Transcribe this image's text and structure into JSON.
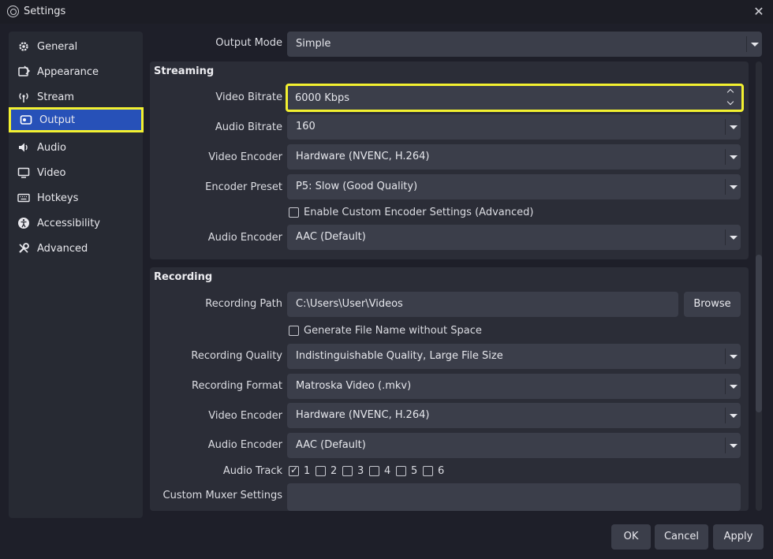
{
  "window": {
    "title": "Settings",
    "close": "✕"
  },
  "sidebar": {
    "items": [
      {
        "label": "General",
        "icon": "gear-icon"
      },
      {
        "label": "Appearance",
        "icon": "palette-icon"
      },
      {
        "label": "Stream",
        "icon": "antenna-icon"
      },
      {
        "label": "Output",
        "icon": "output-icon",
        "active": true
      },
      {
        "label": "Audio",
        "icon": "speaker-icon"
      },
      {
        "label": "Video",
        "icon": "monitor-icon"
      },
      {
        "label": "Hotkeys",
        "icon": "keyboard-icon"
      },
      {
        "label": "Accessibility",
        "icon": "accessibility-icon"
      },
      {
        "label": "Advanced",
        "icon": "wrench-icon"
      }
    ]
  },
  "output_mode": {
    "label": "Output Mode",
    "value": "Simple"
  },
  "streaming": {
    "title": "Streaming",
    "video_bitrate": {
      "label": "Video Bitrate",
      "value": "6000 Kbps"
    },
    "audio_bitrate": {
      "label": "Audio Bitrate",
      "value": "160"
    },
    "video_encoder": {
      "label": "Video Encoder",
      "value": "Hardware (NVENC, H.264)"
    },
    "encoder_preset": {
      "label": "Encoder Preset",
      "value": "P5: Slow (Good Quality)"
    },
    "custom_encoder": {
      "label": "Enable Custom Encoder Settings (Advanced)",
      "checked": false
    },
    "audio_encoder": {
      "label": "Audio Encoder",
      "value": "AAC (Default)"
    }
  },
  "recording": {
    "title": "Recording",
    "path": {
      "label": "Recording Path",
      "value": "C:\\Users\\User\\Videos",
      "browse": "Browse"
    },
    "no_space": {
      "label": "Generate File Name without Space",
      "checked": false
    },
    "quality": {
      "label": "Recording Quality",
      "value": "Indistinguishable Quality, Large File Size"
    },
    "format": {
      "label": "Recording Format",
      "value": "Matroska Video (.mkv)"
    },
    "video_encoder": {
      "label": "Video Encoder",
      "value": "Hardware (NVENC, H.264)"
    },
    "audio_encoder": {
      "label": "Audio Encoder",
      "value": "AAC (Default)"
    },
    "audio_track": {
      "label": "Audio Track",
      "tracks": [
        {
          "num": "1",
          "checked": true
        },
        {
          "num": "2",
          "checked": false
        },
        {
          "num": "3",
          "checked": false
        },
        {
          "num": "4",
          "checked": false
        },
        {
          "num": "5",
          "checked": false
        },
        {
          "num": "6",
          "checked": false
        }
      ]
    },
    "muxer": {
      "label": "Custom Muxer Settings",
      "value": ""
    }
  },
  "buttons": {
    "ok": "OK",
    "cancel": "Cancel",
    "apply": "Apply"
  },
  "colors": {
    "highlight": "#f3f130",
    "active_item": "#2751b8",
    "field_bg": "#3b3e4a"
  }
}
